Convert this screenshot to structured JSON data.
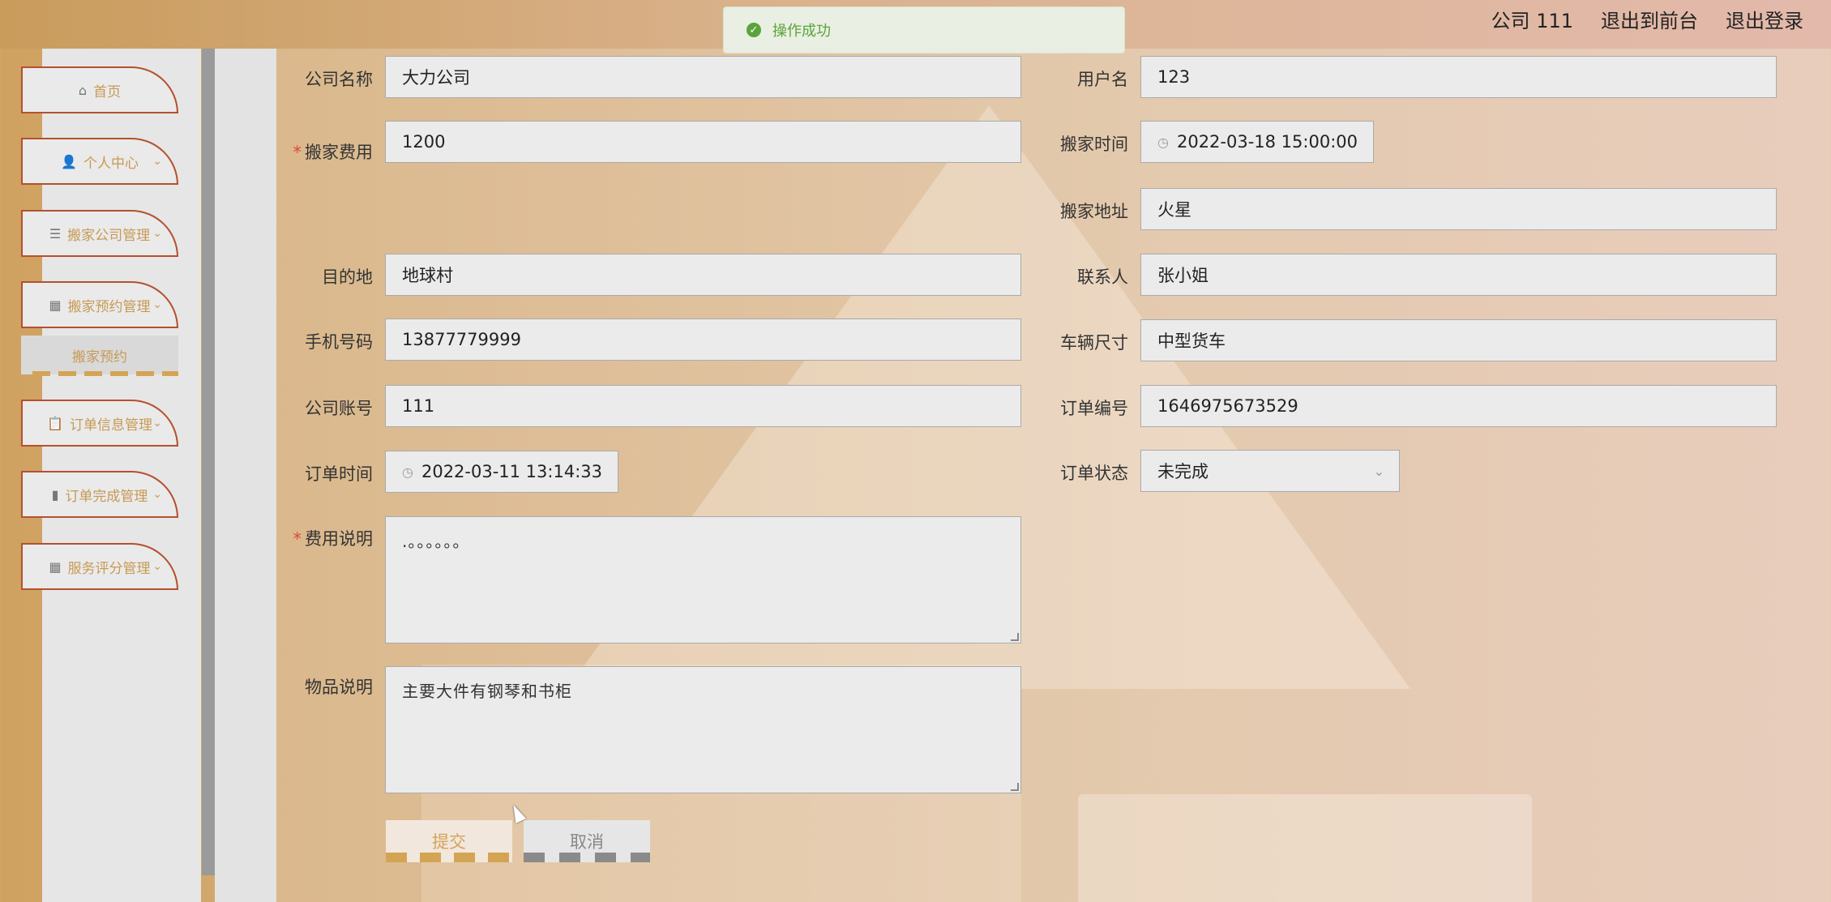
{
  "header": {
    "title": "",
    "user": "公司 111",
    "back_front": "退出到前台",
    "logout": "退出登录"
  },
  "toast": {
    "message": "操作成功"
  },
  "sidebar": {
    "items": [
      {
        "label": "首页",
        "icon": "home-icon"
      },
      {
        "label": "个人中心",
        "icon": "user-icon"
      },
      {
        "label": "搬家公司管理",
        "icon": "list-icon"
      },
      {
        "label": "搬家预约管理",
        "icon": "grid-icon"
      },
      {
        "label": "订单信息管理",
        "icon": "clipboard-icon"
      },
      {
        "label": "订单完成管理",
        "icon": "bar-chart-icon"
      },
      {
        "label": "服务评分管理",
        "icon": "grid-icon"
      }
    ],
    "sub_item": "搬家预约"
  },
  "form": {
    "company_name": {
      "label": "公司名称",
      "value": "大力公司"
    },
    "username": {
      "label": "用户名",
      "value": "123"
    },
    "moving_fee": {
      "label": "搬家费用",
      "value": "1200"
    },
    "moving_time": {
      "label": "搬家时间",
      "value": "2022-03-18 15:00:00"
    },
    "moving_address": {
      "label": "搬家地址",
      "value": "火星"
    },
    "destination": {
      "label": "目的地",
      "value": "地球村"
    },
    "contact": {
      "label": "联系人",
      "value": "张小姐"
    },
    "phone": {
      "label": "手机号码",
      "value": "13877779999"
    },
    "vehicle_size": {
      "label": "车辆尺寸",
      "value": "中型货车"
    },
    "company_account": {
      "label": "公司账号",
      "value": "111"
    },
    "order_number": {
      "label": "订单编号",
      "value": "1646975673529"
    },
    "order_time": {
      "label": "订单时间",
      "value": "2022-03-11 13:14:33"
    },
    "order_status": {
      "label": "订单状态",
      "value": "未完成"
    },
    "fee_description": {
      "label": "费用说明",
      "value": ".。。。。。。"
    },
    "item_description": {
      "label": "物品说明",
      "value": "主要大件有钢琴和书柜"
    },
    "submit": "提交",
    "cancel": "取消"
  }
}
